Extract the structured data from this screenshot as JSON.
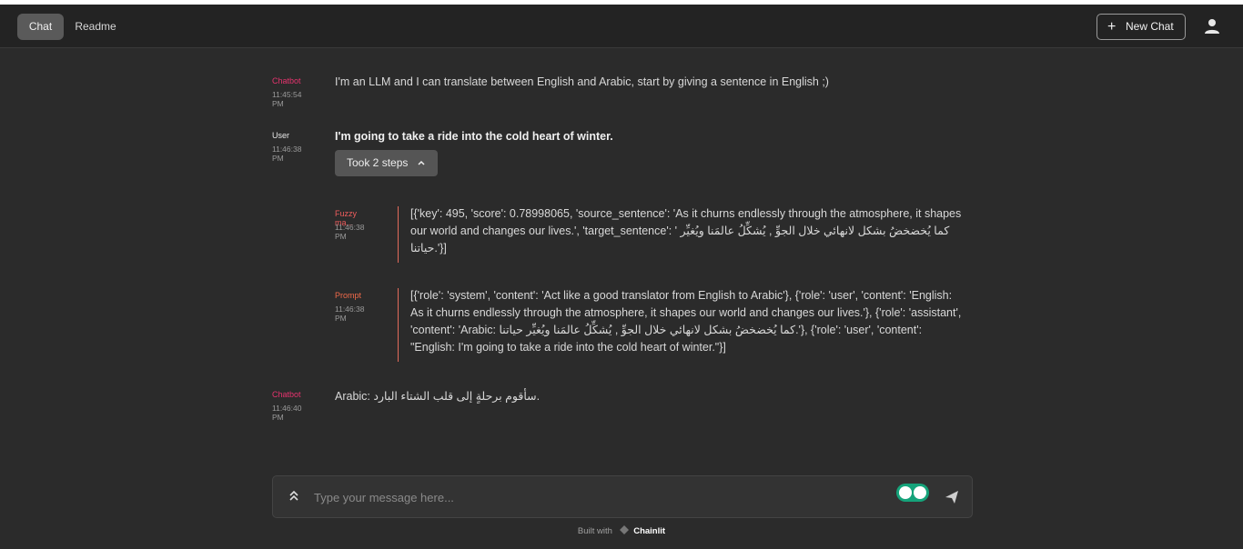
{
  "header": {
    "tabs": [
      {
        "label": "Chat",
        "active": true
      },
      {
        "label": "Readme",
        "active": false
      }
    ],
    "new_chat_label": "New Chat",
    "user_icon": "user-icon"
  },
  "messages": [
    {
      "author": "Chatbot",
      "time": "11:45:54 PM",
      "text": "I'm an LLM and I can translate between English and Arabic, start by giving a sentence in English ;)"
    },
    {
      "author": "User",
      "time": "11:46:38 PM",
      "text": "I'm going to take a ride into the cold heart of winter.",
      "steps_label": "Took 2 steps"
    },
    {
      "author": "Chatbot",
      "time": "11:46:40 PM",
      "text": "Arabic: سأقوم برحلةٍ إلى قلب الشتاء البارد."
    }
  ],
  "steps": [
    {
      "author": "Fuzzy ma...",
      "time": "11:46:38 PM",
      "text": "[{'key': 495, 'score': 0.78998065, 'source_sentence': 'As it churns endlessly through the atmosphere, it shapes our world and changes our lives.', 'target_sentence': ' كما يُخضخضُ بشكل لانهائي خلال الجوِّ , يُشكِّلُ عالمَنا ويُغيِّر حياتنا.'}]"
    },
    {
      "author": "Prompt",
      "time": "11:46:38 PM",
      "text": "[{'role': 'system', 'content': 'Act like a good translator from English to Arabic'}, {'role': 'user', 'content': 'English: As it churns endlessly through the atmosphere, it shapes our world and changes our lives.'}, {'role': 'assistant', 'content': 'Arabic: كما يُخضخضُ بشكل لانهائي خلال الجوِّ , يُشكِّلُ عالمَنا ويُغيِّر حياتنا.'}, {'role': 'user', 'content': \"English: I'm going to take a ride into the cold heart of winter.\"}]"
    }
  ],
  "composer": {
    "placeholder": "Type your message here..."
  },
  "footer": {
    "built_with": "Built with",
    "brand": "Chainlit"
  },
  "colors": {
    "background": "#2b2b2b",
    "header": "#232323",
    "chatbot_author": "#e6336e",
    "step_rule": "#e26b5b"
  }
}
